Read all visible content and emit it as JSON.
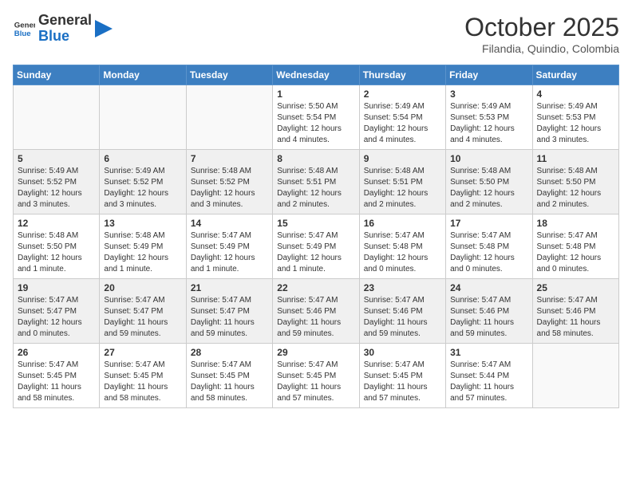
{
  "header": {
    "logo_general": "General",
    "logo_blue": "Blue",
    "month": "October 2025",
    "location": "Filandia, Quindio, Colombia"
  },
  "days_of_week": [
    "Sunday",
    "Monday",
    "Tuesday",
    "Wednesday",
    "Thursday",
    "Friday",
    "Saturday"
  ],
  "weeks": [
    [
      {
        "day": "",
        "info": ""
      },
      {
        "day": "",
        "info": ""
      },
      {
        "day": "",
        "info": ""
      },
      {
        "day": "1",
        "info": "Sunrise: 5:50 AM\nSunset: 5:54 PM\nDaylight: 12 hours\nand 4 minutes."
      },
      {
        "day": "2",
        "info": "Sunrise: 5:49 AM\nSunset: 5:54 PM\nDaylight: 12 hours\nand 4 minutes."
      },
      {
        "day": "3",
        "info": "Sunrise: 5:49 AM\nSunset: 5:53 PM\nDaylight: 12 hours\nand 4 minutes."
      },
      {
        "day": "4",
        "info": "Sunrise: 5:49 AM\nSunset: 5:53 PM\nDaylight: 12 hours\nand 3 minutes."
      }
    ],
    [
      {
        "day": "5",
        "info": "Sunrise: 5:49 AM\nSunset: 5:52 PM\nDaylight: 12 hours\nand 3 minutes."
      },
      {
        "day": "6",
        "info": "Sunrise: 5:49 AM\nSunset: 5:52 PM\nDaylight: 12 hours\nand 3 minutes."
      },
      {
        "day": "7",
        "info": "Sunrise: 5:48 AM\nSunset: 5:52 PM\nDaylight: 12 hours\nand 3 minutes."
      },
      {
        "day": "8",
        "info": "Sunrise: 5:48 AM\nSunset: 5:51 PM\nDaylight: 12 hours\nand 2 minutes."
      },
      {
        "day": "9",
        "info": "Sunrise: 5:48 AM\nSunset: 5:51 PM\nDaylight: 12 hours\nand 2 minutes."
      },
      {
        "day": "10",
        "info": "Sunrise: 5:48 AM\nSunset: 5:50 PM\nDaylight: 12 hours\nand 2 minutes."
      },
      {
        "day": "11",
        "info": "Sunrise: 5:48 AM\nSunset: 5:50 PM\nDaylight: 12 hours\nand 2 minutes."
      }
    ],
    [
      {
        "day": "12",
        "info": "Sunrise: 5:48 AM\nSunset: 5:50 PM\nDaylight: 12 hours\nand 1 minute."
      },
      {
        "day": "13",
        "info": "Sunrise: 5:48 AM\nSunset: 5:49 PM\nDaylight: 12 hours\nand 1 minute."
      },
      {
        "day": "14",
        "info": "Sunrise: 5:47 AM\nSunset: 5:49 PM\nDaylight: 12 hours\nand 1 minute."
      },
      {
        "day": "15",
        "info": "Sunrise: 5:47 AM\nSunset: 5:49 PM\nDaylight: 12 hours\nand 1 minute."
      },
      {
        "day": "16",
        "info": "Sunrise: 5:47 AM\nSunset: 5:48 PM\nDaylight: 12 hours\nand 0 minutes."
      },
      {
        "day": "17",
        "info": "Sunrise: 5:47 AM\nSunset: 5:48 PM\nDaylight: 12 hours\nand 0 minutes."
      },
      {
        "day": "18",
        "info": "Sunrise: 5:47 AM\nSunset: 5:48 PM\nDaylight: 12 hours\nand 0 minutes."
      }
    ],
    [
      {
        "day": "19",
        "info": "Sunrise: 5:47 AM\nSunset: 5:47 PM\nDaylight: 12 hours\nand 0 minutes."
      },
      {
        "day": "20",
        "info": "Sunrise: 5:47 AM\nSunset: 5:47 PM\nDaylight: 11 hours\nand 59 minutes."
      },
      {
        "day": "21",
        "info": "Sunrise: 5:47 AM\nSunset: 5:47 PM\nDaylight: 11 hours\nand 59 minutes."
      },
      {
        "day": "22",
        "info": "Sunrise: 5:47 AM\nSunset: 5:46 PM\nDaylight: 11 hours\nand 59 minutes."
      },
      {
        "day": "23",
        "info": "Sunrise: 5:47 AM\nSunset: 5:46 PM\nDaylight: 11 hours\nand 59 minutes."
      },
      {
        "day": "24",
        "info": "Sunrise: 5:47 AM\nSunset: 5:46 PM\nDaylight: 11 hours\nand 59 minutes."
      },
      {
        "day": "25",
        "info": "Sunrise: 5:47 AM\nSunset: 5:46 PM\nDaylight: 11 hours\nand 58 minutes."
      }
    ],
    [
      {
        "day": "26",
        "info": "Sunrise: 5:47 AM\nSunset: 5:45 PM\nDaylight: 11 hours\nand 58 minutes."
      },
      {
        "day": "27",
        "info": "Sunrise: 5:47 AM\nSunset: 5:45 PM\nDaylight: 11 hours\nand 58 minutes."
      },
      {
        "day": "28",
        "info": "Sunrise: 5:47 AM\nSunset: 5:45 PM\nDaylight: 11 hours\nand 58 minutes."
      },
      {
        "day": "29",
        "info": "Sunrise: 5:47 AM\nSunset: 5:45 PM\nDaylight: 11 hours\nand 57 minutes."
      },
      {
        "day": "30",
        "info": "Sunrise: 5:47 AM\nSunset: 5:45 PM\nDaylight: 11 hours\nand 57 minutes."
      },
      {
        "day": "31",
        "info": "Sunrise: 5:47 AM\nSunset: 5:44 PM\nDaylight: 11 hours\nand 57 minutes."
      },
      {
        "day": "",
        "info": ""
      }
    ]
  ]
}
